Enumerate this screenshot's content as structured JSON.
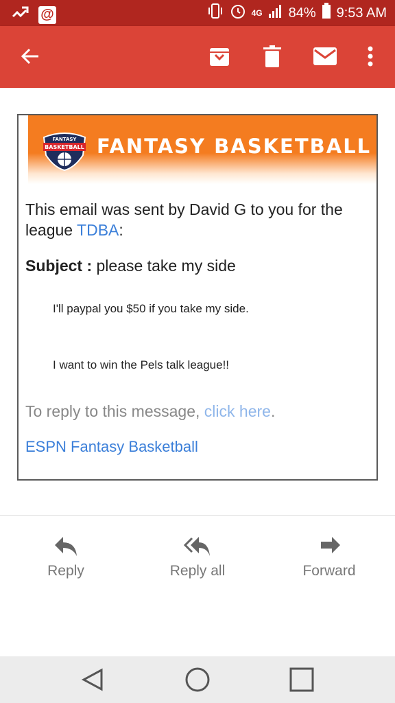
{
  "status_bar": {
    "network": "4G",
    "battery": "84%",
    "time": "9:53 AM"
  },
  "app_bar": {
    "icons": [
      "back-arrow-icon",
      "archive-icon",
      "delete-icon",
      "mark-unread-icon",
      "more-vert-icon"
    ]
  },
  "email": {
    "banner_title": "FANTASY BASKETBALL",
    "logo_text_top": "FANTASY",
    "logo_text_bottom": "BASKETBALL",
    "intro_text": "This email was sent by David G to you for the league ",
    "league_link": "TDBA",
    "intro_suffix": ":",
    "subject_label": "Subject :",
    "subject_value": "please take my side",
    "message_line1": "I'll paypal you $50 if you take my side.",
    "message_line2": "I want to win the Pels talk league!!",
    "reply_prefix": "To reply to this message, ",
    "reply_link": "click here",
    "reply_suffix": ".",
    "footer_link": "ESPN Fantasy Basketball"
  },
  "actions": {
    "reply": "Reply",
    "reply_all": "Reply all",
    "forward": "Forward"
  },
  "colors": {
    "status_bar": "#b0261f",
    "app_bar": "#db4437",
    "banner": "#f47c20",
    "link": "#3b7fd9"
  }
}
